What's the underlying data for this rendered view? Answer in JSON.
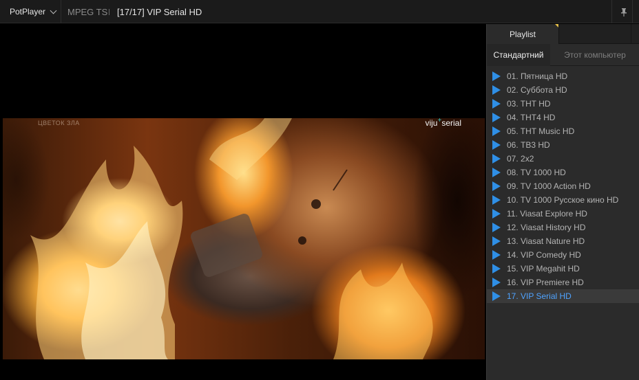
{
  "titlebar": {
    "app_name": "PotPlayer",
    "format": "MPEG TS",
    "title": "[17/17] VIP Serial HD"
  },
  "video": {
    "watermark_left": "ЦВЕТОК ЗЛА",
    "logo_brand": "viju",
    "logo_plus": "+",
    "logo_word": "serial"
  },
  "panel": {
    "tab_playlist": "Playlist",
    "subtab_standard": "Стандартний",
    "subtab_computer": "Этот компьютер",
    "items": [
      {
        "label": "01. Пятница HD"
      },
      {
        "label": "02. Суббота HD"
      },
      {
        "label": "03. THT HD"
      },
      {
        "label": "04. THT4 HD"
      },
      {
        "label": "05. THT Music HD"
      },
      {
        "label": "06. ТВ3 HD"
      },
      {
        "label": "07. 2x2"
      },
      {
        "label": "08. TV 1000 HD"
      },
      {
        "label": "09. TV 1000 Action HD"
      },
      {
        "label": "10. TV 1000 Русское кино HD"
      },
      {
        "label": "11. Viasat Explore HD"
      },
      {
        "label": "12. Viasat History HD"
      },
      {
        "label": "13. Viasat Nature HD"
      },
      {
        "label": "14. VIP Comedy HD"
      },
      {
        "label": "15. VIP Megahit HD"
      },
      {
        "label": "16. VIP Premiere HD"
      },
      {
        "label": "17. VIP Serial HD"
      }
    ],
    "current_index": 16,
    "accent_color": "#2f8fe6"
  }
}
